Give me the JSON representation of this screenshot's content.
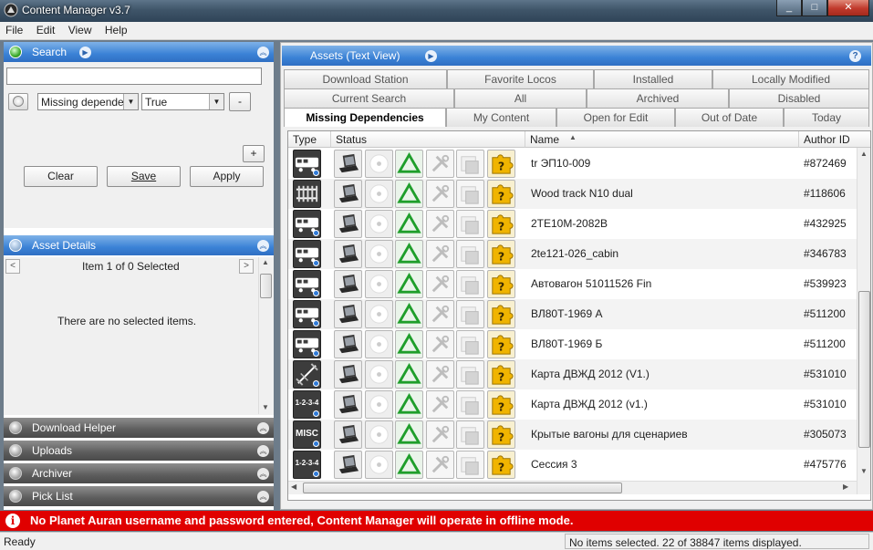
{
  "window": {
    "title": "Content Manager v3.7",
    "minimize": "_",
    "maximize": "□",
    "close": "✕"
  },
  "menu": [
    "File",
    "Edit",
    "View",
    "Help"
  ],
  "search_panel": {
    "title": "Search",
    "text_value": "",
    "filter_field": "Missing dependenc",
    "filter_value": "True",
    "remove_button": "-",
    "add_button": "+",
    "clear_button": "Clear",
    "save_button": "Save",
    "apply_button": "Apply"
  },
  "asset_details": {
    "title": "Asset Details",
    "pager_text": "Item 1 of 0 Selected",
    "prev": "<",
    "next": ">",
    "empty_text": "There are no selected items."
  },
  "collapsed_panels": [
    "Download Helper",
    "Uploads",
    "Archiver",
    "Pick List"
  ],
  "assets_panel": {
    "title": "Assets (Text View)",
    "help": "?"
  },
  "tabs_row1": [
    "Download Station",
    "Favorite Locos",
    "Installed",
    "Locally Modified"
  ],
  "tabs_row2": [
    "Current Search",
    "All",
    "Archived",
    "Disabled"
  ],
  "tabs_row3": [
    "Missing Dependencies",
    "My Content",
    "Open for Edit",
    "Out of Date",
    "Today"
  ],
  "active_tab": "Missing Dependencies",
  "columns": {
    "type": "Type",
    "status": "Status",
    "name": "Name",
    "author": "Author ID"
  },
  "sort": {
    "column": "Name",
    "direction": "ascending"
  },
  "rows": [
    {
      "type_icon": "loco-icon",
      "type_label": "",
      "name": "tr ЭП10-009",
      "author": "#872469"
    },
    {
      "type_icon": "track-icon",
      "type_label": "",
      "name": "Wood track N10 dual",
      "author": "#118606"
    },
    {
      "type_icon": "loco-icon",
      "type_label": "",
      "name": "2ТЕ10М-2082В",
      "author": "#432925"
    },
    {
      "type_icon": "loco-icon",
      "type_label": "",
      "name": "2te121-026_cabin",
      "author": "#346783"
    },
    {
      "type_icon": "loco-icon",
      "type_label": "",
      "name": "Автовагон 51011526 Fin",
      "author": "#539923"
    },
    {
      "type_icon": "loco-icon",
      "type_label": "",
      "name": "ВЛ80Т-1969 А",
      "author": "#511200"
    },
    {
      "type_icon": "loco-icon",
      "type_label": "",
      "name": "ВЛ80Т-1969 Б",
      "author": "#511200"
    },
    {
      "type_icon": "route-icon",
      "type_label": "",
      "name": "Карта ДВЖД 2012 (V1.)",
      "author": "#531010"
    },
    {
      "type_icon": "session-icon",
      "type_label": "1-2-3-4",
      "name": "Карта ДВЖД 2012 (v1.)",
      "author": "#531010"
    },
    {
      "type_icon": "misc-icon",
      "type_label": "MISC",
      "name": "Крытые вагоны для сценариев",
      "author": "#305073"
    },
    {
      "type_icon": "session-icon",
      "type_label": "1-2-3-4",
      "name": "Сессия 3",
      "author": "#475776"
    }
  ],
  "status_icons": [
    "laptop-icon",
    "disc-icon",
    "triangle-icon",
    "tools-icon",
    "box-icon",
    "question-puzzle-icon"
  ],
  "error_message": "No Planet Auran username and password entered, Content Manager will operate in offline mode.",
  "status": {
    "left": "Ready",
    "right": "No items selected. 22 of 38847 items displayed."
  },
  "colors": {
    "accent": "#3b82d6",
    "error": "#e00000",
    "triangle": "#1f9e2b",
    "question": "#f0b400"
  }
}
